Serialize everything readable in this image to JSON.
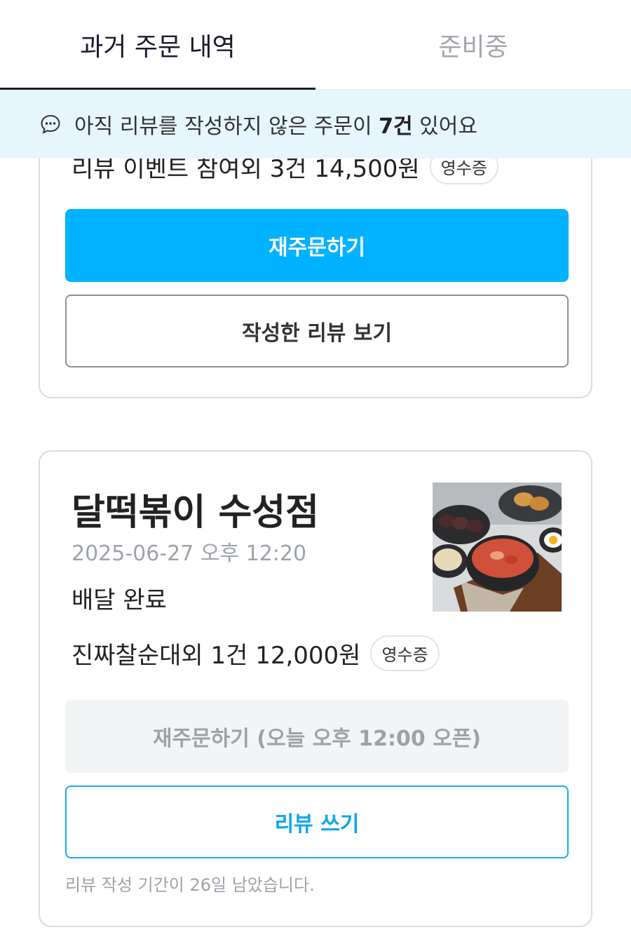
{
  "tabs": {
    "past_orders": "과거 주문 내역",
    "preparing": "준비중"
  },
  "notice": {
    "prefix": "아직 리뷰를 작성하지 않은 주문이",
    "count": "7건",
    "suffix": "있어요",
    "icon": "chat-bubble-icon"
  },
  "order1": {
    "items_summary": "리뷰 이벤트 참여외 3건 14,500원",
    "receipt_label": "영수증",
    "reorder_label": "재주문하기",
    "view_review_label": "작성한 리뷰 보기"
  },
  "order2": {
    "store_name": "달떡볶이 수성점",
    "date": "2025-06-27 오후 12:20",
    "status": "배달 완료",
    "items_summary": "진짜찰순대외 1건 12,000원",
    "receipt_label": "영수증",
    "reorder_label": "재주문하기 (오늘 오후 12:00 오픈)",
    "write_review_label": "리뷰 쓰기",
    "review_deadline": "리뷰 작성 기간이 26일 남았습니다."
  },
  "colors": {
    "accent": "#00b2ff",
    "banner": "#e6f6fd",
    "tab_active": "#1c1a2e"
  }
}
